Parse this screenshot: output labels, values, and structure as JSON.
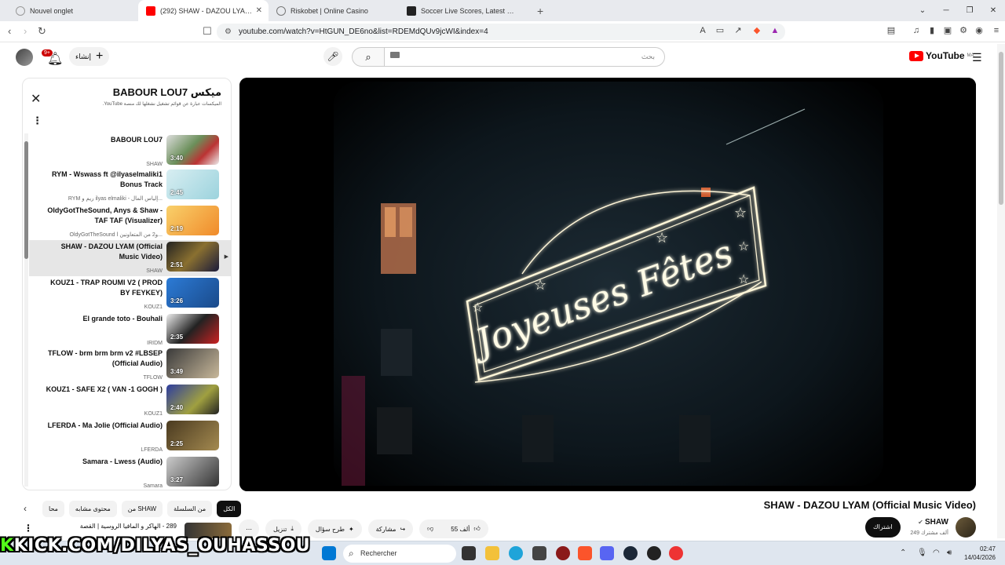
{
  "browser": {
    "tabs": [
      {
        "title": "Nouvel onglet",
        "active": false
      },
      {
        "title": "(292) SHAW - DAZOU LYAM (",
        "active": true
      },
      {
        "title": "Riskobet | Online Casino",
        "active": false
      },
      {
        "title": "Soccer Live Scores, Latest Soccer Res",
        "active": false
      }
    ],
    "url": "youtube.com/watch?v=HtGUN_DE6no&list=RDEMdQUv9jcWI&index=4"
  },
  "header": {
    "notif_count": "9+",
    "create_label": "إنشاء",
    "search_placeholder": "بحث",
    "logo_text": "YouTube",
    "region": "MA"
  },
  "playlist": {
    "title": "ميكس BABOUR LOU7",
    "subtitle": "الميكسات عبارة عن قوائم تشغيل نشغلها لك منصة YouTube.",
    "items": [
      {
        "title": "BABOUR LOU7",
        "channel": "SHAW",
        "duration": "3:40",
        "current": false
      },
      {
        "title": "RYM - Wswass ft @ilyaselmaliki1 Bonus Track",
        "channel": "RYM ريم و ilyas elmaliki - إلياس المال...",
        "duration": "2:45",
        "current": false
      },
      {
        "title": "OldyGotTheSound, Anys & Shaw - TAF TAF (Visualizer)",
        "channel": "OldyGotTheSound و2 من المتعاونين ا...",
        "duration": "2:19",
        "current": false
      },
      {
        "title": "SHAW - DAZOU LYAM (Official Music Video)",
        "channel": "SHAW",
        "duration": "2:51",
        "current": true
      },
      {
        "title": "KOUZ1 - TRAP ROUMI V2 ( PROD BY FEYKEY)",
        "channel": "KOUZ1",
        "duration": "3:26",
        "current": false
      },
      {
        "title": "El grande toto - Bouhali",
        "channel": "IRIDM",
        "duration": "2:35",
        "current": false
      },
      {
        "title": "TFLOW - brm brm brm v2 #LBSEP (Official Audio)",
        "channel": "TFLOW",
        "duration": "3:49",
        "current": false
      },
      {
        "title": "KOUZ1 - SAFE X2 ( VAN -1 GOGH )",
        "channel": "KOUZ1",
        "duration": "2:40",
        "current": false
      },
      {
        "title": "LFERDA - Ma Jolie (Official Audio)",
        "channel": "LFERDA",
        "duration": "2:25",
        "current": false
      },
      {
        "title": "Samara - Lwess (Audio)",
        "channel": "Samara",
        "duration": "3:27",
        "current": false
      }
    ]
  },
  "video": {
    "title": "SHAW - DAZOU LYAM (Official Music Video)",
    "sign_text": "Joyeuses Fêtes"
  },
  "chips": [
    "الكل",
    "من السلسلة",
    "من SHAW",
    "محتوى مشابه",
    "محا"
  ],
  "actions": {
    "like_count": "55 ألف",
    "share": "مشاركة",
    "ask": "طرح سؤال",
    "download": "تنزيل",
    "subscribe": "اشتراك"
  },
  "channel": {
    "name": "SHAW",
    "subscribers": "249 ألف مشترك"
  },
  "related": {
    "title": "289 - الهاكر و المافيا الروسية | القصة"
  },
  "watermark": {
    "k": "K",
    "text": "KICK.COM/DILYAS_OUHASSOU"
  },
  "taskbar": {
    "search_placeholder": "Rechercher",
    "time": "02:47",
    "date": "14/04/2026"
  }
}
